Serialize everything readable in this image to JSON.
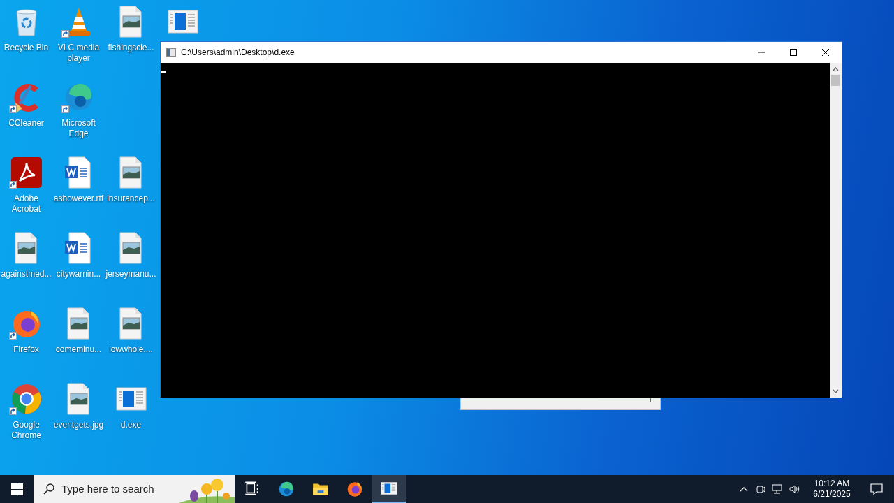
{
  "desktop": {
    "rows": [
      [
        {
          "label": "Recycle Bin",
          "kind": "recycle",
          "shortcut": false
        },
        {
          "label": "VLC media player",
          "kind": "vlc",
          "shortcut": true
        },
        {
          "label": "fishingscie...",
          "kind": "image",
          "shortcut": false
        }
      ],
      [
        {
          "label": "CCleaner",
          "kind": "ccleaner",
          "shortcut": true
        },
        {
          "label": "Microsoft Edge",
          "kind": "edge",
          "shortcut": true
        }
      ],
      [
        {
          "label": "Adobe Acrobat",
          "kind": "acrobat",
          "shortcut": true
        },
        {
          "label": "ashowever.rtf",
          "kind": "word",
          "shortcut": false
        },
        {
          "label": "insurancep...",
          "kind": "image",
          "shortcut": false
        }
      ],
      [
        {
          "label": "againstmed...",
          "kind": "image",
          "shortcut": false
        },
        {
          "label": "citywarnin...",
          "kind": "word",
          "shortcut": false
        },
        {
          "label": "jerseymanu...",
          "kind": "image",
          "shortcut": false
        }
      ],
      [
        {
          "label": "Firefox",
          "kind": "firefox",
          "shortcut": true
        },
        {
          "label": "comeminu...",
          "kind": "image",
          "shortcut": false
        },
        {
          "label": "lowwhole....",
          "kind": "image",
          "shortcut": false
        }
      ],
      [
        {
          "label": "Google Chrome",
          "kind": "chrome",
          "shortcut": true
        },
        {
          "label": "eventgets.jpg",
          "kind": "image",
          "shortcut": false
        },
        {
          "label": "d.exe",
          "kind": "exe",
          "shortcut": false
        }
      ]
    ],
    "covered_icons": [
      {
        "kind": "exe"
      }
    ]
  },
  "window": {
    "title": "C:\\Users\\admin\\Desktop\\d.exe"
  },
  "taskbar": {
    "search": {
      "placeholder": "Type here to search"
    },
    "apps": [
      {
        "kind": "taskview",
        "selected": false
      },
      {
        "kind": "edge",
        "selected": false
      },
      {
        "kind": "folder",
        "selected": false
      },
      {
        "kind": "firefox",
        "selected": false
      },
      {
        "kind": "exe",
        "selected": true
      }
    ],
    "clock": {
      "time": "10:12 AM",
      "date": "6/21/2025"
    }
  }
}
